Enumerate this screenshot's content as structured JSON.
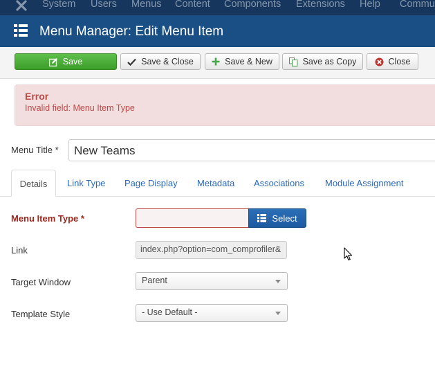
{
  "topnav": {
    "logo_icon": "joomla-logo-icon",
    "items": [
      "System",
      "Users",
      "Menus",
      "Content",
      "Components",
      "Extensions",
      "Help",
      "Commu"
    ]
  },
  "header": {
    "icon": "list-grid-icon",
    "title": "Menu Manager: Edit Menu Item"
  },
  "toolbar": {
    "save_label": "Save",
    "save_close_label": "Save & Close",
    "save_new_label": "Save & New",
    "save_copy_label": "Save as Copy",
    "close_label": "Close"
  },
  "alert": {
    "heading": "Error",
    "message": "Invalid field:  Menu Item Type"
  },
  "form": {
    "menu_title_label": "Menu Title *",
    "menu_title_value": "New Teams",
    "menu_item_type_label": "Menu Item Type *",
    "menu_item_type_value": "",
    "select_button_label": "Select",
    "link_label": "Link",
    "link_value": "index.php?option=com_comprofiler&",
    "target_window_label": "Target Window",
    "target_window_value": "Parent",
    "template_style_label": "Template Style",
    "template_style_value": "- Use Default -"
  },
  "tabs": [
    "Details",
    "Link Type",
    "Page Display",
    "Metadata",
    "Associations",
    "Module Assignment"
  ],
  "colors": {
    "topnav_bg": "#17365d",
    "header_bg": "#1a4f86",
    "save_green": "#46a546",
    "error_text": "#b94a48",
    "error_bg": "#f2dede",
    "link_blue": "#2a69b8",
    "select_blue": "#1f5fa8"
  }
}
